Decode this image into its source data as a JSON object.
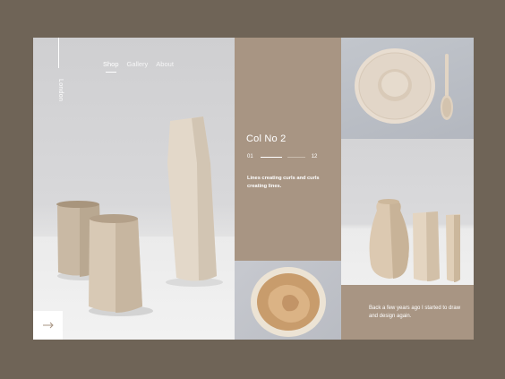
{
  "brand": {
    "location": "London"
  },
  "nav": {
    "items": [
      {
        "label": "Shop"
      },
      {
        "label": "Gallery"
      },
      {
        "label": "About"
      }
    ]
  },
  "feature": {
    "title": "Col No 2",
    "pager_start": "01",
    "pager_end": "12",
    "description": "Lines creating curls and curls creating lines."
  },
  "story": {
    "text": "Back a few years ago I started to draw and design again."
  },
  "icons": {
    "next": "arrow-right-icon"
  },
  "colors": {
    "accent": "#a89583",
    "background": "#6f6457"
  }
}
